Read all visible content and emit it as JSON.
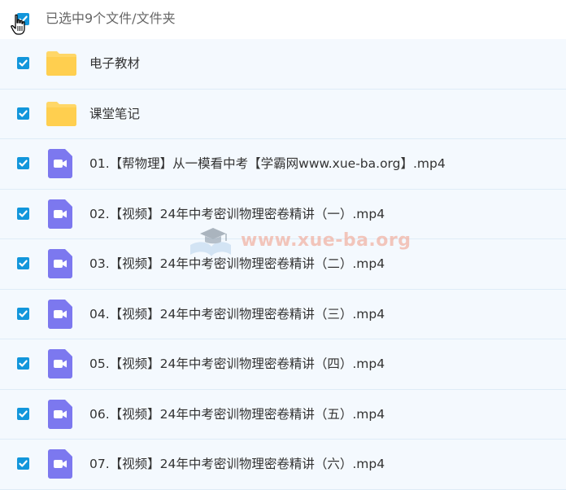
{
  "header": {
    "selection_text": "已选中9个文件/文件夹"
  },
  "files": [
    {
      "type": "folder",
      "name": "电子教材"
    },
    {
      "type": "folder",
      "name": "课堂笔记"
    },
    {
      "type": "video",
      "name": "01.【帮物理】从一模看中考【学霸网www.xue-ba.org】.mp4"
    },
    {
      "type": "video",
      "name": "02.【视频】24年中考密训物理密卷精讲（一）.mp4"
    },
    {
      "type": "video",
      "name": "03.【视频】24年中考密训物理密卷精讲（二）.mp4"
    },
    {
      "type": "video",
      "name": "04.【视频】24年中考密训物理密卷精讲（三）.mp4"
    },
    {
      "type": "video",
      "name": "05.【视频】24年中考密训物理密卷精讲（四）.mp4"
    },
    {
      "type": "video",
      "name": "06.【视频】24年中考密训物理密卷精讲（五）.mp4"
    },
    {
      "type": "video",
      "name": "07.【视频】24年中考密训物理密卷精讲（六）.mp4"
    }
  ],
  "watermark": {
    "text": "www.xue-ba.org"
  },
  "colors": {
    "checkbox": "#1296db",
    "folder": "#ffd767",
    "video_icon": "#7c78ef",
    "row_background": "#f4f9fe"
  }
}
